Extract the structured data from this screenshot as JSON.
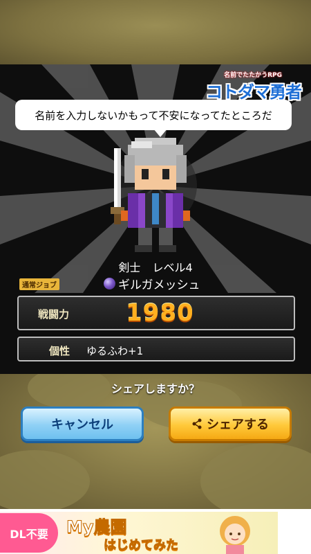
{
  "header": {
    "logo_subtitle": "名前でたたかうRPG",
    "logo_title": "コトダマ勇者"
  },
  "dialog": {
    "speech": "名前を入力しないかもって不安になってたところだ"
  },
  "character": {
    "job": "剣士",
    "level": "レベル4",
    "job_type_badge": "通常ジョブ",
    "name": "ギルガメッシュ",
    "power_label": "戦闘力",
    "power_value": "1980",
    "trait_label": "個性",
    "trait_value": "ゆるふわ+1"
  },
  "share": {
    "question": "シェアしますか？",
    "cancel_label": "キャンセル",
    "share_label": "シェアする"
  },
  "ad": {
    "dl_label": "DL不要",
    "title": "My農園",
    "subtitle": "はじめてみた"
  },
  "colors": {
    "panel_bg": "#0e0e0e",
    "power_value": "#ffb020",
    "cancel_button": "#8fd0f5",
    "share_button": "#ffc93a",
    "frame_bg": "#7a6f3f"
  }
}
